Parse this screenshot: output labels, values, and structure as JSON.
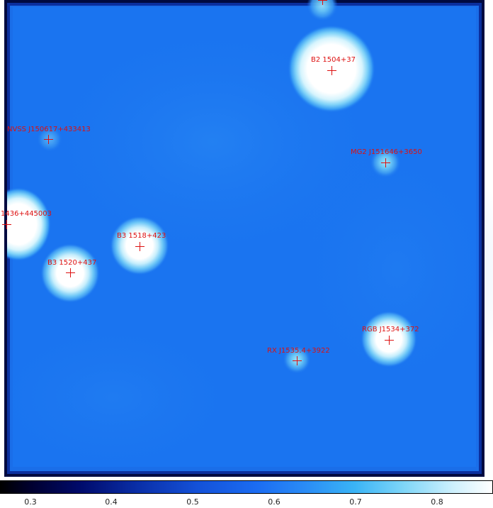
{
  "colorbar": {
    "ticks": [
      "0.3",
      "0.4",
      "0.5",
      "0.6",
      "0.7",
      "0.8"
    ]
  },
  "sources": [
    {
      "id": "b2-1504",
      "label": "B2 1504+37"
    },
    {
      "id": "nvss-j150617",
      "label": "NVSS J150617+433413"
    },
    {
      "id": "mg2-j151646",
      "label": "MG2 J151646+3650"
    },
    {
      "id": "j1436",
      "label": "1436+445003"
    },
    {
      "id": "b3-1518",
      "label": "B3 1518+423"
    },
    {
      "id": "b3-1520",
      "label": "B3 1520+437"
    },
    {
      "id": "rgb-j1534",
      "label": "RGB J1534+372"
    },
    {
      "id": "rx-j1535",
      "label": "RX J1535.4+3922"
    }
  ],
  "colors": {
    "marker": "#dd1010",
    "field": "#1a74f0",
    "frame": "#00126a"
  }
}
